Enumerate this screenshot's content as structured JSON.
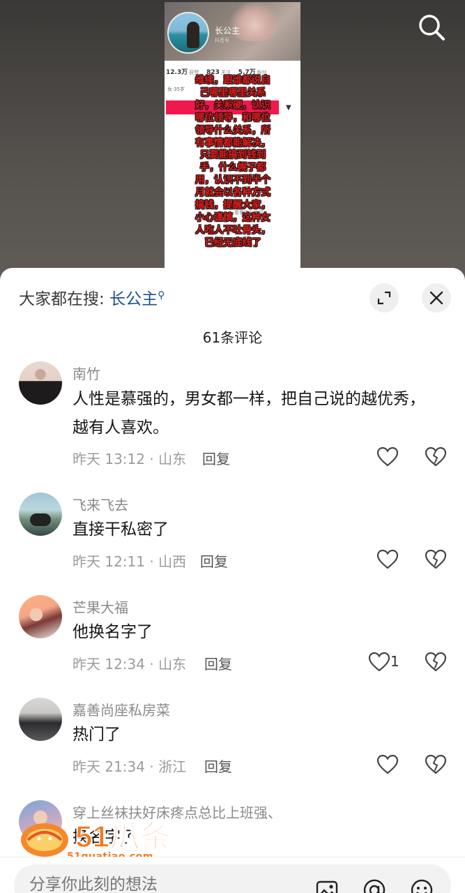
{
  "video": {
    "profile_name": "长公主",
    "profile_sub": "抖音号",
    "stats": [
      {
        "value": "12.3万",
        "label": "获赞"
      },
      {
        "value": "823",
        "label": "关注"
      },
      {
        "value": "5.7万",
        "label": "粉丝"
      }
    ],
    "meta_line": "女·35岁",
    "faint_text": "看看她的作品",
    "overlay_lines": [
      "维续，跟谁都说自",
      "己哪里哪里关系",
      "好，关系硬，认识",
      "哪位领导，和哪位",
      "领导什么关系，所",
      "有事情都能解决，",
      "只要能搞到钱到",
      "手，什么幌子都",
      "用，认识不到半个",
      "月就会以各种方式",
      "搞钱，提醒大家，",
      "小心谨慎，这种女",
      "人吃人不吐骨头，",
      "已经无底线了"
    ]
  },
  "sheet": {
    "search_prefix": "大家都在搜:",
    "search_keyword": "长公主",
    "comment_count": "61条评论"
  },
  "comments": [
    {
      "user": "南竹",
      "text": "人性是慕强的，男女都一样，把自己说的越优秀，越有人喜欢。",
      "meta": "昨天 13:12 · 山东",
      "reply": "回复",
      "likes": ""
    },
    {
      "user": "飞来飞去",
      "text": "直接干私密了",
      "meta": "昨天 12:11 · 山西",
      "reply": "回复",
      "likes": ""
    },
    {
      "user": "芒果大福",
      "text": "他换名字了",
      "meta": "昨天 12:34 · 山东",
      "reply": "回复",
      "likes": "1"
    },
    {
      "user": "嘉善尚座私房菜",
      "text": "热门了",
      "meta": "昨天 21:34 · 浙江",
      "reply": "回复",
      "likes": ""
    },
    {
      "user": "穿上丝袜扶好床疼点总比上班强、",
      "text": "换名字了",
      "meta": "",
      "reply": "",
      "likes": ""
    }
  ],
  "watermark": {
    "logo": "51瓜条",
    "url": "51guatiao.com"
  },
  "input": {
    "placeholder": "分享你此刻的想法"
  },
  "colors": {
    "keyword": "#1f4f8d",
    "overlay_text": "#e11b1b",
    "highlight_bar": "#f0194f",
    "watermark": "#f07a1f"
  },
  "icons": [
    "search-icon",
    "expand-icon",
    "close-icon",
    "heart-icon",
    "broken-heart-icon",
    "image-icon",
    "at-icon",
    "emoji-icon"
  ]
}
